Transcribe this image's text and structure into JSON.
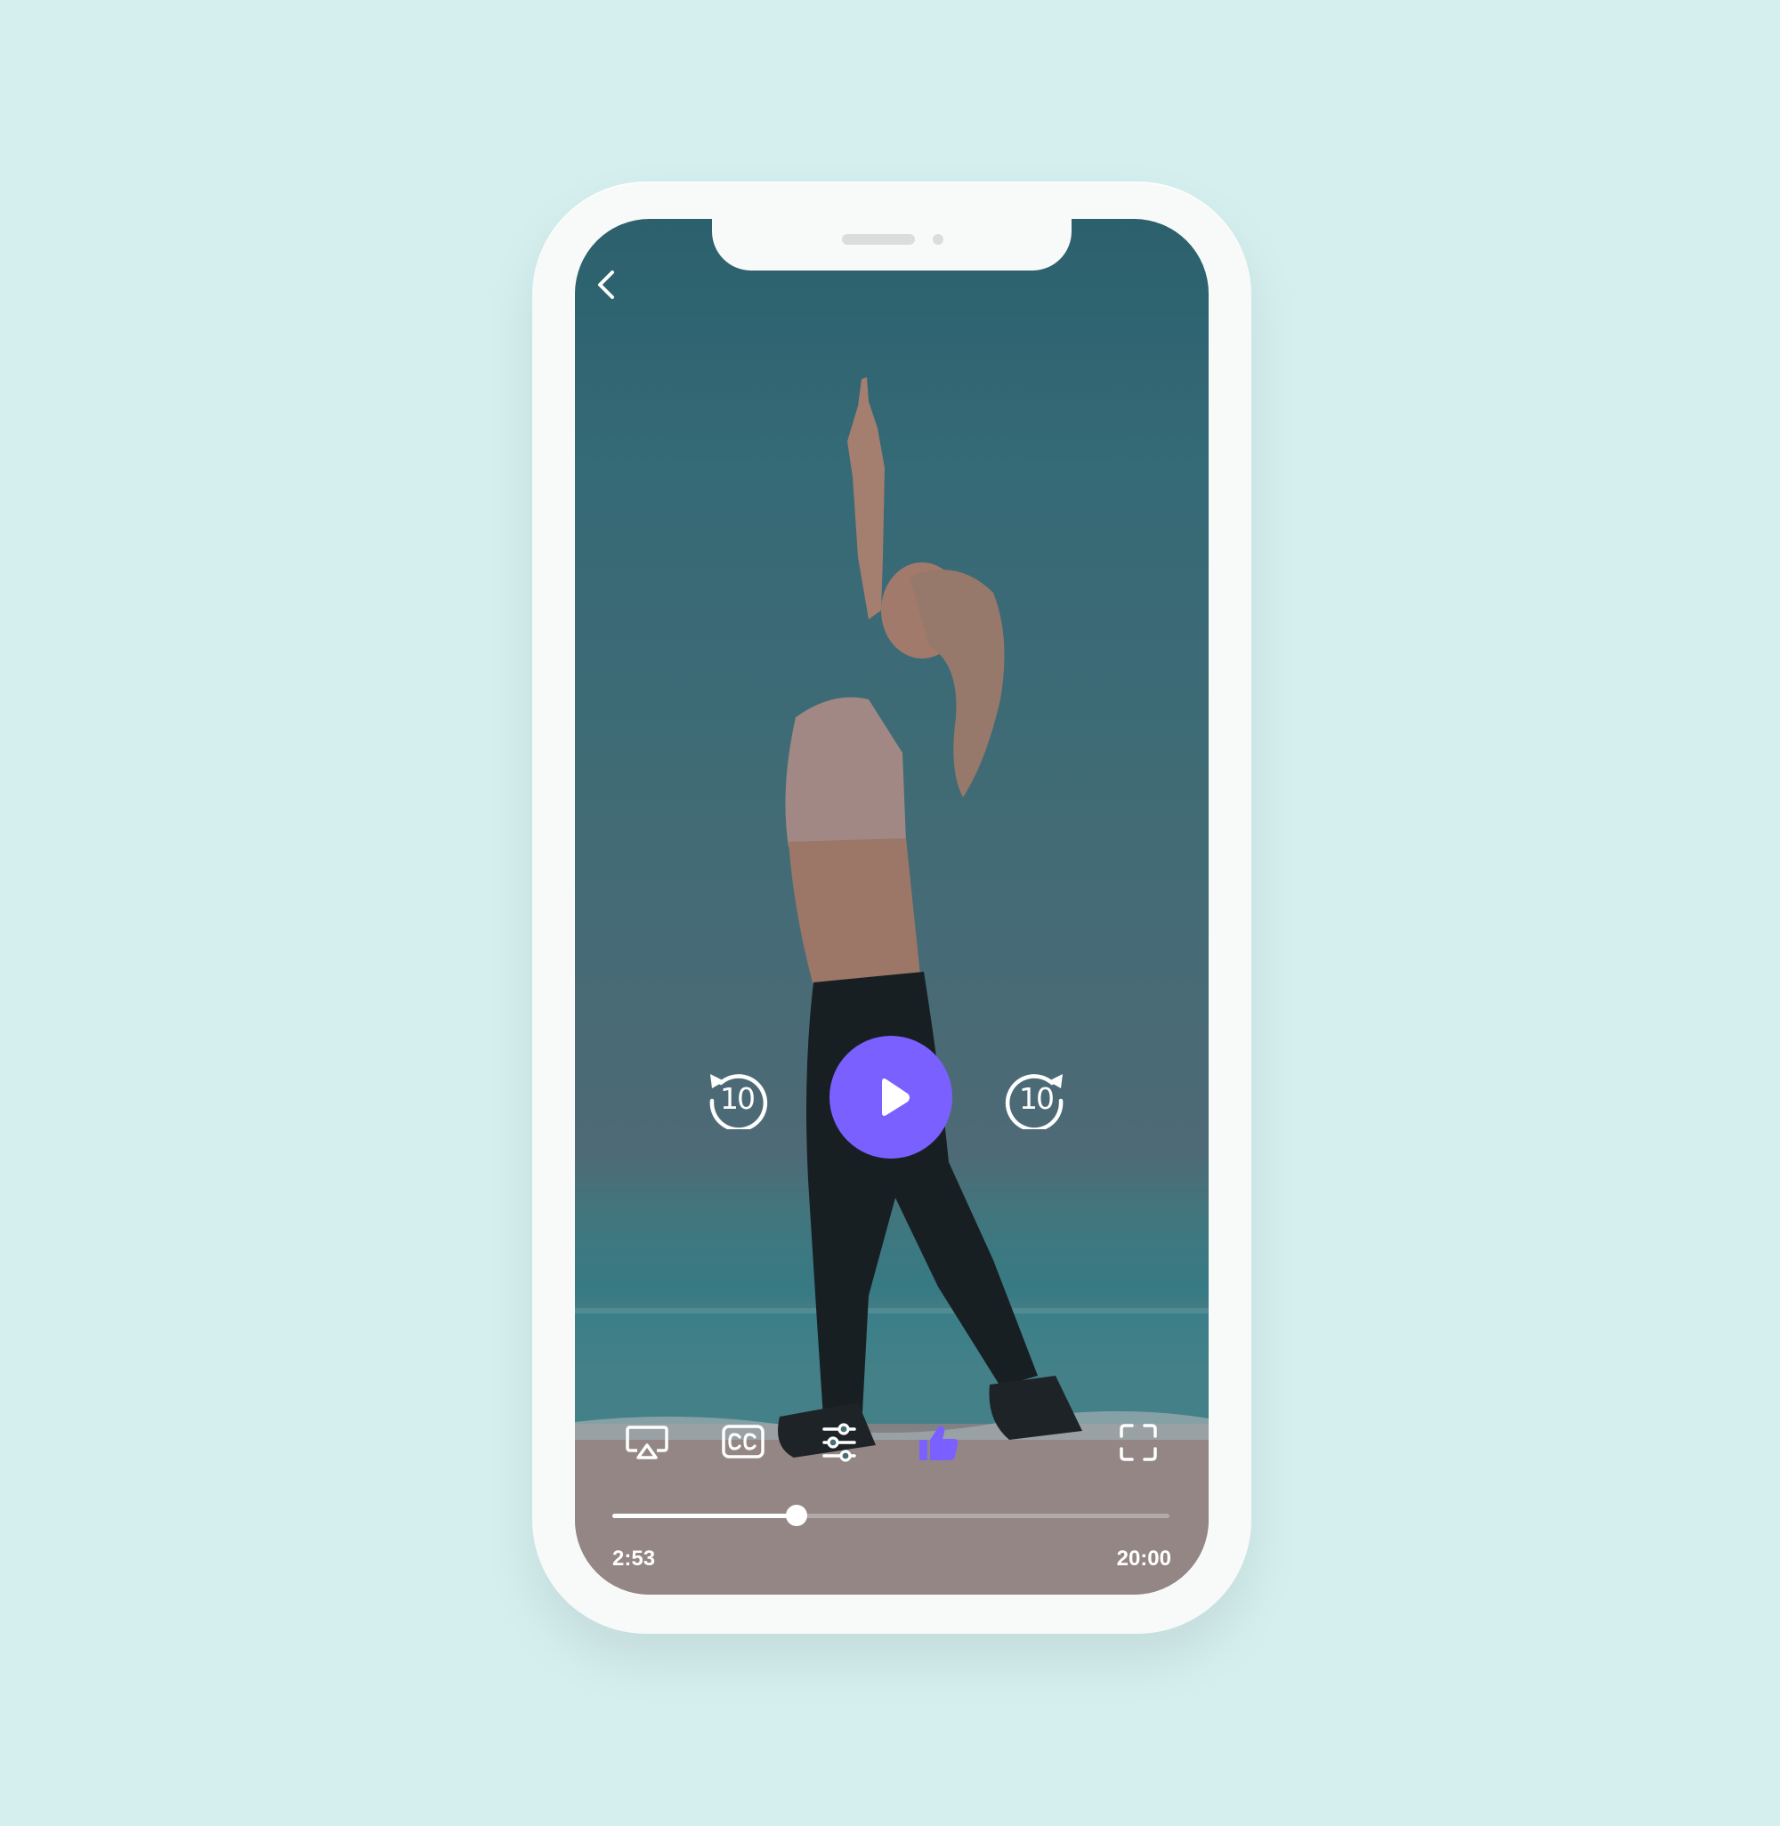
{
  "player": {
    "current_time": "2:53",
    "total_time": "20:00",
    "progress_fraction": 0.33,
    "rewind_seconds": "10",
    "forward_seconds": "10"
  },
  "icons": {
    "back": "chevron-left-icon",
    "rewind": "rewind-10-icon",
    "play": "play-icon",
    "forward": "forward-10-icon",
    "airplay": "airplay-icon",
    "captions": "closed-captions-icon",
    "settings": "sliders-icon",
    "like": "thumbs-up-icon",
    "fullscreen": "fullscreen-icon"
  },
  "colors": {
    "background": "#d4efee",
    "accent": "#7a61ff",
    "phone_body": "#f8f9f9",
    "icon": "#ffffff"
  }
}
